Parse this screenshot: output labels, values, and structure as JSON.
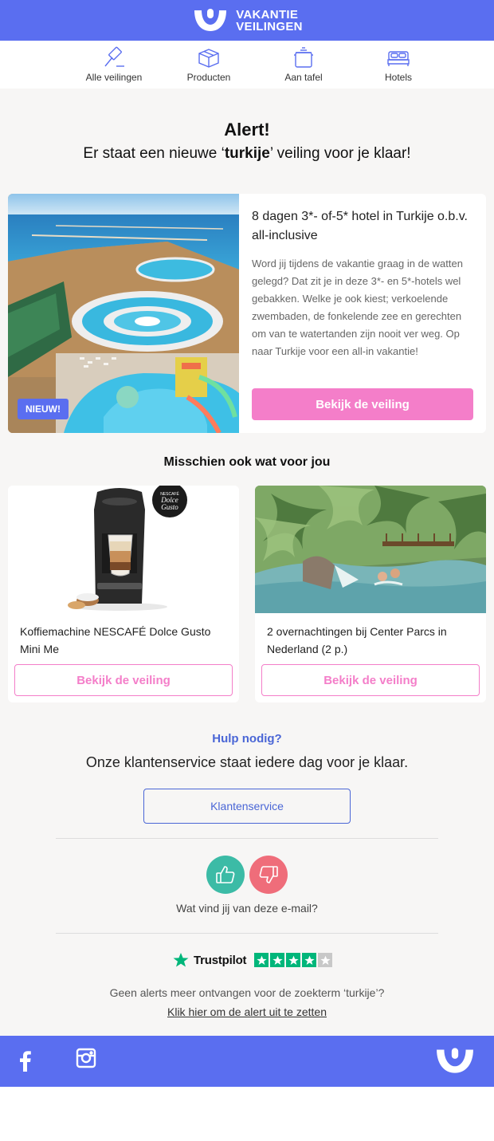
{
  "header": {
    "brand_line1": "VAKANTIE",
    "brand_line2": "VEILINGEN",
    "brand_color": "#5a6ef0"
  },
  "nav": {
    "items": [
      {
        "label": "Alle veilingen",
        "icon": "gavel-icon"
      },
      {
        "label": "Producten",
        "icon": "box-icon"
      },
      {
        "label": "Aan tafel",
        "icon": "cooking-pot-icon"
      },
      {
        "label": "Hotels",
        "icon": "bed-icon"
      }
    ]
  },
  "alert": {
    "title": "Alert!",
    "sub_before": "Er staat een nieuwe ‘",
    "sub_term": "turkije",
    "sub_after": "’ veiling voor je klaar!"
  },
  "main_deal": {
    "badge": "NIEUW!",
    "title": "8 dagen 3*- of-5* hotel in Turkije o.b.v. all-inclusive",
    "description": "Word jij tijdens de vakantie graag in de watten gelegd? Dat zit je in deze 3*- en 5*-hotels wel gebakken. Welke je ook kiest; verkoelende zwembaden, de fonkelende zee en gerechten om van te watertanden zijn nooit ver weg. Op naar Turkije voor een all-in vakantie!",
    "button": "Bekijk de veiling",
    "accent_color": "#f47ec9"
  },
  "suggestions": {
    "title": "Misschien ook wat voor jou",
    "items": [
      {
        "title": "Koffiemachine NESCAFÉ Dolce Gusto Mini Me",
        "button": "Bekijk de veiling",
        "logo_line1": "NESCAFÉ",
        "logo_line2": "Dolce",
        "logo_line3": "Gusto"
      },
      {
        "title": "2 overnachtingen bij Center Parcs in Nederland (2 p.)",
        "button": "Bekijk de veiling"
      }
    ]
  },
  "help": {
    "title": "Hulp nodig?",
    "text": "Onze klantenservice staat iedere dag voor je klaar.",
    "button": "Klantenservice"
  },
  "feedback": {
    "question": "Wat vind jij van deze e-mail?"
  },
  "trustpilot": {
    "name": "Trustpilot",
    "stars": 4,
    "star_color": "#00b67a"
  },
  "unsubscribe": {
    "text": "Geen alerts meer ontvangen voor de zoekterm ‘turkije’?",
    "link": "Klik hier om de alert uit te zetten"
  },
  "footer": {
    "icons": [
      "facebook-icon",
      "instagram-icon",
      "brand-logo-icon"
    ]
  }
}
